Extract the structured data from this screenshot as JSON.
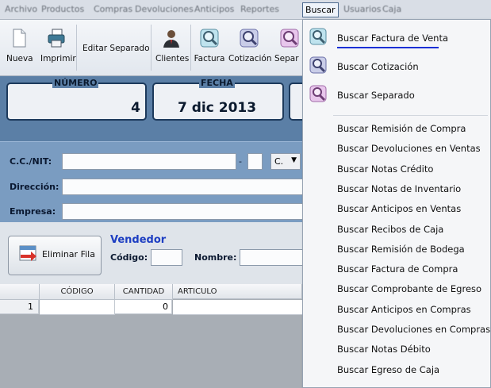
{
  "menubar": {
    "items": [
      "Archivo",
      "Productos",
      "Compras",
      "Devoluciones",
      "Anticipos",
      "Reportes"
    ],
    "buscar_label": "Buscar",
    "after_items": [
      "Usuarios",
      "Caja"
    ]
  },
  "toolbar": {
    "nueva": "Nueva",
    "imprimir": "Imprimir",
    "editar_separado": "Editar Separado",
    "clientes": "Clientes",
    "factura": "Factura",
    "cotizacion": "Cotización",
    "separado": "Separ"
  },
  "header_fields": {
    "numero_label": "NÚMERO",
    "numero_value": "4",
    "fecha_label": "FECHA",
    "fecha_value": "7 dic 2013"
  },
  "client": {
    "ccnit_label": "C.C./NIT:",
    "dash": "-",
    "type_select": "C.",
    "direccion_label": "Dirección:",
    "empresa_label": "Empresa:"
  },
  "actions": {
    "eliminar_fila": "Eliminar Fila"
  },
  "vendedor": {
    "title": "Vendedor",
    "codigo_label": "Código:",
    "nombre_label": "Nombre:"
  },
  "grid": {
    "headers": [
      "CÓDIGO",
      "CANTIDAD",
      "ARTICULO"
    ],
    "rows": [
      {
        "num": "1",
        "codigo": "",
        "cantidad": "0",
        "articulo": ""
      }
    ]
  },
  "buscar_menu": {
    "icon_items": [
      "Buscar Factura de Venta",
      "Buscar Cotización",
      "Buscar Separado"
    ],
    "items": [
      "Buscar Remisión de Compra",
      "Buscar Devoluciones en Ventas",
      "Buscar Notas Crédito",
      "Buscar Notas de Inventario",
      "Buscar Anticipos en Ventas",
      "Buscar Recibos de Caja",
      "Buscar Remisión de Bodega",
      "Buscar Factura de Compra",
      "Buscar Comprobante de Egreso",
      "Buscar Anticipos en Compras",
      "Buscar Devoluciones en Compras",
      "Buscar Notas Débito",
      "Buscar Egreso de Caja"
    ]
  },
  "colors": {
    "background": "#5b7fa6",
    "highlight_underline": "#1a2fd6"
  }
}
